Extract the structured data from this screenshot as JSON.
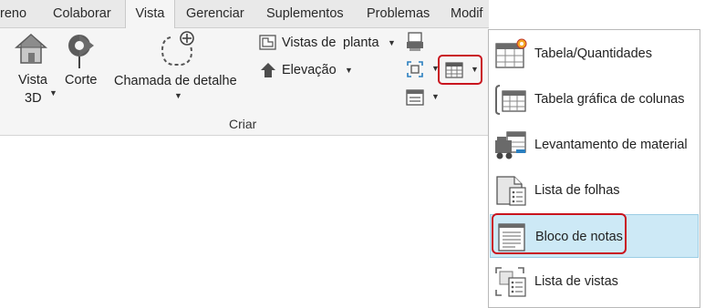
{
  "tabs": [
    "reno",
    "Colaborar",
    "Vista",
    "Gerenciar",
    "Suplementos",
    "Problemas",
    "Modif"
  ],
  "active_tab": "Vista",
  "ribbon": {
    "vista3d_line1": "Vista",
    "vista3d_line2": "3D",
    "corte": "Corte",
    "chamada": "Chamada de detalhe",
    "vistas_planta_a": "Vistas de",
    "vistas_planta_b": "planta",
    "elevacao": "Elevação",
    "group": "Criar"
  },
  "menu": {
    "items": [
      {
        "label": "Tabela/Quantidades",
        "icon": "schedule-quantities-icon"
      },
      {
        "label": "Tabela gráfica de colunas",
        "icon": "graphical-column-schedule-icon"
      },
      {
        "label": "Levantamento de material",
        "icon": "material-takeoff-icon"
      },
      {
        "label": "Lista de folhas",
        "icon": "sheet-list-icon"
      },
      {
        "label": "Bloco de notas",
        "icon": "note-block-icon"
      },
      {
        "label": "Lista de vistas",
        "icon": "view-list-icon"
      }
    ]
  },
  "colors": {
    "highlight": "#cde9f6",
    "callout_red": "#c9141e",
    "ribbon_bg": "#f5f5f5"
  }
}
